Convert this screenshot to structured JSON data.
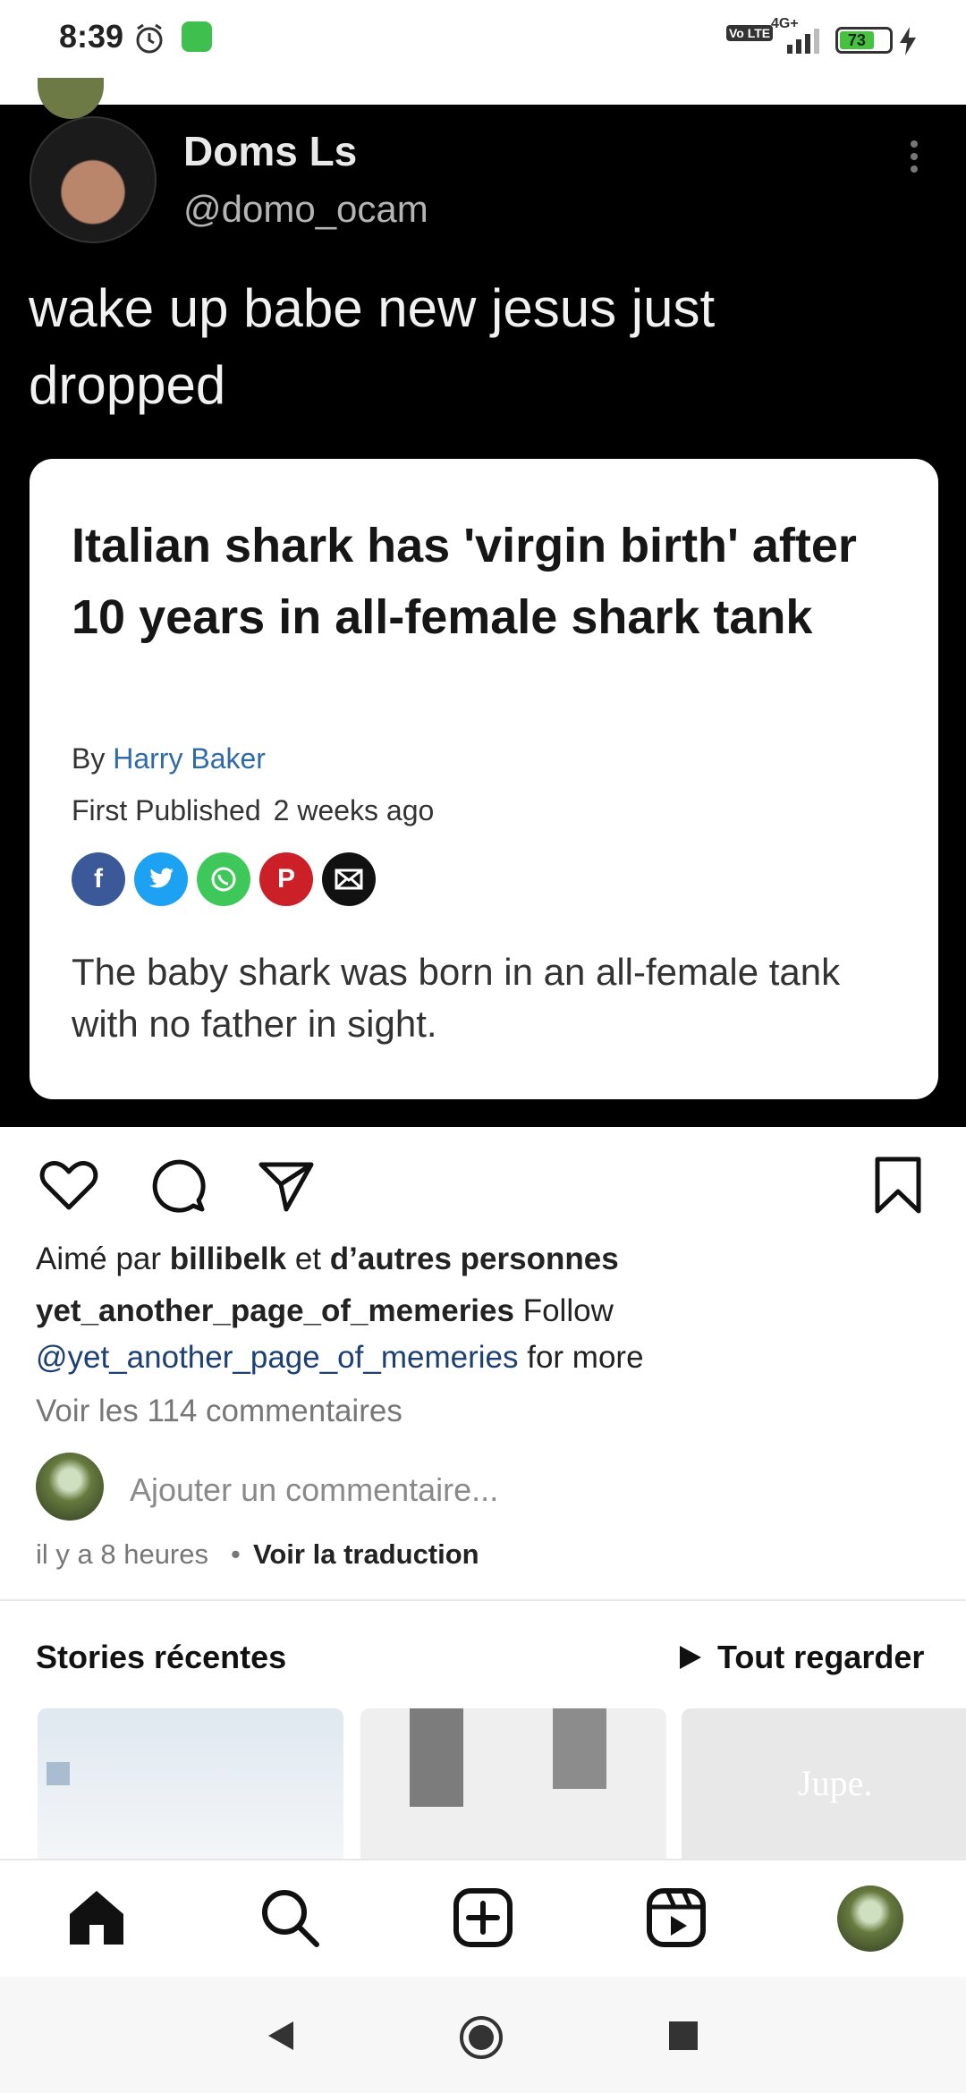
{
  "status_bar": {
    "time": "8:39",
    "battery": "73",
    "network": "4G+",
    "volte": "Vo LTE"
  },
  "post": {
    "tweet": {
      "name": "Doms Ls",
      "handle": "@domo_ocam",
      "text": "wake up babe new jesus just dropped"
    },
    "article": {
      "title": "Italian shark has 'virgin birth' after 10 years in all-female shark tank",
      "by_prefix": "By",
      "author": "Harry Baker",
      "published_label": "First Published",
      "published_ago": "2 weeks ago",
      "share_icons": [
        "facebook-icon",
        "twitter-icon",
        "whatsapp-icon",
        "pinterest-icon",
        "email-icon"
      ],
      "description": "The baby shark was born in an all-female tank with no father in sight."
    }
  },
  "actions": {
    "liked_prefix": "Aimé par",
    "liked_user": "billibelk",
    "liked_and": "et",
    "liked_others": "d’autres personnes"
  },
  "caption": {
    "username": "yet_another_page_of_memeries",
    "text_before": "Follow",
    "mention": "@yet_another_page_of_memeries",
    "text_after": "for more"
  },
  "comments_link": "Voir les 114 commentaires",
  "add_comment_placeholder": "Ajouter un commentaire...",
  "time_ago": "il y a 8 heures",
  "translate": "Voir la traduction",
  "stories": {
    "title": "Stories récentes",
    "see_all": "Tout regarder",
    "story3_text": "Jupe."
  },
  "colors": {
    "mention": "#1c3f74",
    "link_blue": "#2f6aa8"
  }
}
